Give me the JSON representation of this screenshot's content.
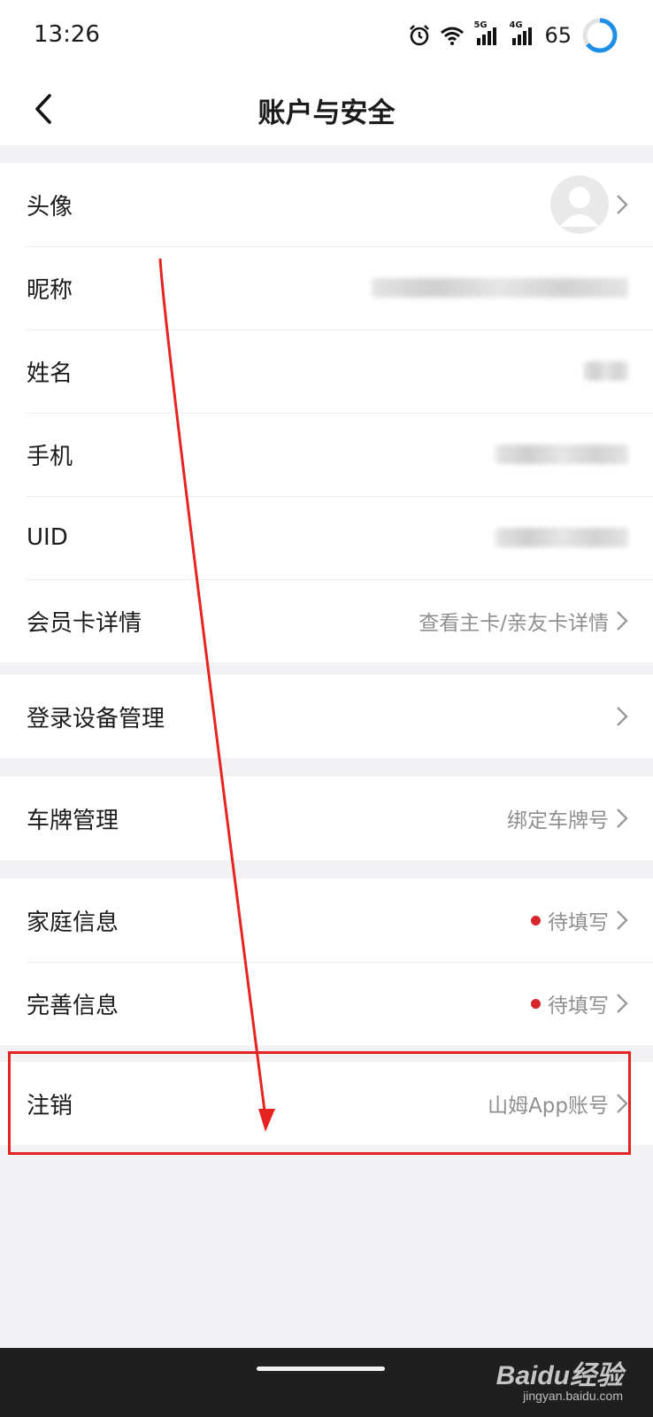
{
  "status_bar": {
    "time": "13:26",
    "network_5g": "5G",
    "network_4g": "4G",
    "battery": "65"
  },
  "nav": {
    "title": "账户与安全"
  },
  "groups": {
    "profile": {
      "avatar_label": "头像",
      "nickname_label": "昵称",
      "name_label": "姓名",
      "phone_label": "手机",
      "uid_label": "UID",
      "membership_label": "会员卡详情",
      "membership_value": "查看主卡/亲友卡详情"
    },
    "device": {
      "label": "登录设备管理"
    },
    "plate": {
      "label": "车牌管理",
      "value": "绑定车牌号"
    },
    "info": {
      "family_label": "家庭信息",
      "family_value": "待填写",
      "complete_label": "完善信息",
      "complete_value": "待填写"
    },
    "cancel": {
      "label": "注销",
      "value": "山姆App账号"
    }
  },
  "watermark": {
    "brand": "Baidu经验",
    "url": "jingyan.baidu.com"
  },
  "colors": {
    "accent_red": "#e52421",
    "dot_red": "#d9262c",
    "battery_blue": "#1e8fe6"
  }
}
